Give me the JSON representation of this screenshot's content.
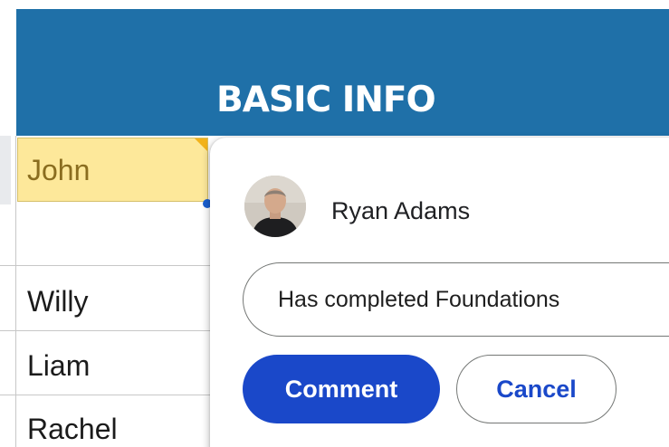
{
  "sheet": {
    "section_header": "BASIC INFO",
    "selected_cell": "John",
    "rows": [
      "Willy",
      "Liam",
      "Rachel"
    ]
  },
  "comment": {
    "author": "Ryan Adams",
    "input_value": "Has completed Foundations",
    "comment_label": "Comment",
    "cancel_label": "Cancel"
  },
  "colors": {
    "header_bg": "#1f70a8",
    "selected_cell_bg": "#fde89a",
    "primary_button": "#1a48c9"
  }
}
